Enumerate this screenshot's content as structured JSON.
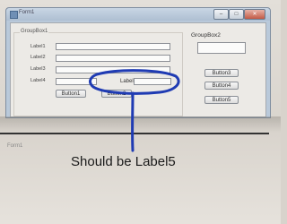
{
  "window": {
    "title": "Form1",
    "min_glyph": "–",
    "max_glyph": "□",
    "close_glyph": "✕"
  },
  "groupbox1": {
    "caption": "GroupBox1",
    "labels": [
      "Label1",
      "Label2",
      "Label3",
      "Label4"
    ],
    "inline_label": "Label",
    "buttons": [
      "Button1",
      "Button2"
    ]
  },
  "groupbox2": {
    "caption": "GroupBox2",
    "buttons": [
      "Button3",
      "Button4",
      "Button5"
    ]
  },
  "below": {
    "caption": "Form1"
  },
  "annotation": {
    "text": "Should be Label5",
    "ink_color": "#1f3bb3"
  }
}
